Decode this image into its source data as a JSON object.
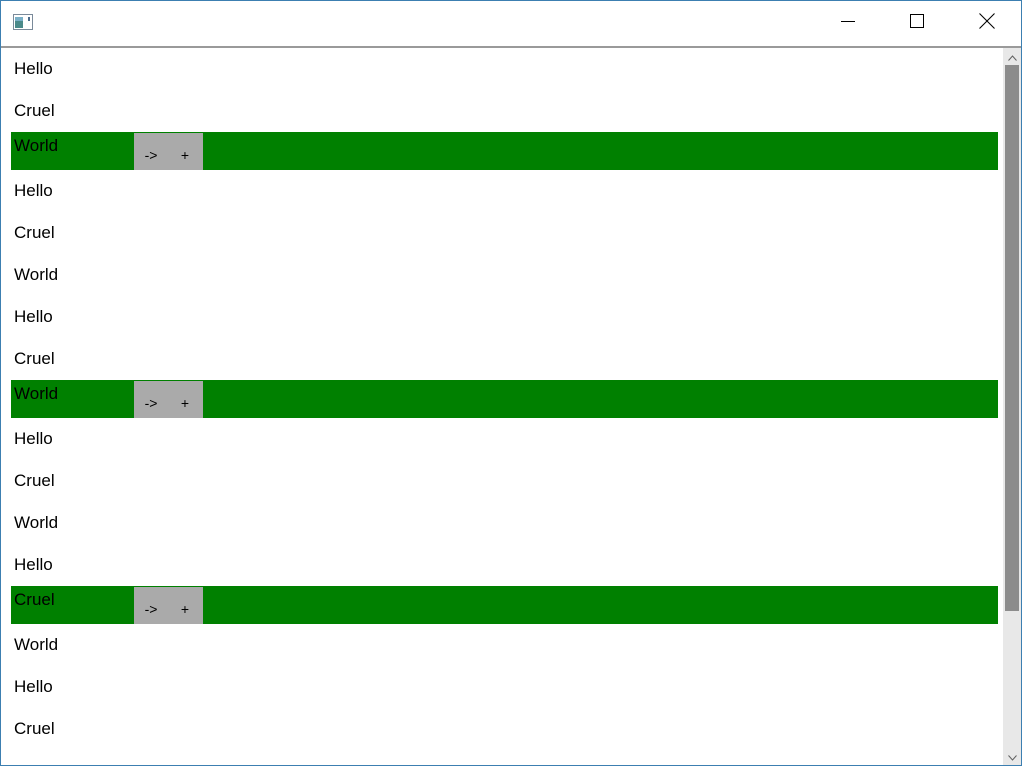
{
  "window": {
    "controls": {
      "minimize_icon": "minimize-icon",
      "maximize_icon": "maximize-icon",
      "close_icon": "close-icon"
    }
  },
  "list": {
    "highlight_color": "#008000",
    "button_color": "#aaaaaa",
    "items": [
      {
        "text": "Hello",
        "highlighted": false
      },
      {
        "text": "Cruel",
        "highlighted": false
      },
      {
        "text": "World",
        "highlighted": true,
        "buttons": [
          "->",
          "+"
        ]
      },
      {
        "text": "Hello",
        "highlighted": false
      },
      {
        "text": "Cruel",
        "highlighted": false
      },
      {
        "text": "World",
        "highlighted": false
      },
      {
        "text": "Hello",
        "highlighted": false
      },
      {
        "text": "Cruel",
        "highlighted": false
      },
      {
        "text": "World",
        "highlighted": true,
        "buttons": [
          "->",
          "+"
        ]
      },
      {
        "text": "Hello",
        "highlighted": false
      },
      {
        "text": "Cruel",
        "highlighted": false
      },
      {
        "text": "World",
        "highlighted": false
      },
      {
        "text": "Hello",
        "highlighted": false
      },
      {
        "text": "Cruel",
        "highlighted": true,
        "buttons": [
          "->",
          "+"
        ]
      },
      {
        "text": "World",
        "highlighted": false
      },
      {
        "text": "Hello",
        "highlighted": false
      },
      {
        "text": "Cruel",
        "highlighted": false
      }
    ]
  }
}
